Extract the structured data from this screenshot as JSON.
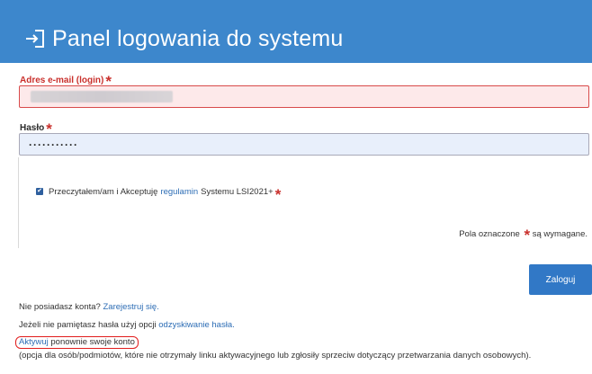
{
  "header": {
    "title": "Panel logowania do systemu",
    "icon": "login-icon",
    "background_color": "#3d87cc"
  },
  "form": {
    "email": {
      "label": "Adres e-mail (login)",
      "required_mark": "*",
      "value": "",
      "state": "error"
    },
    "password": {
      "label": "Hasło",
      "required_mark": "*",
      "value": "···········"
    },
    "terms": {
      "checked": true,
      "text_before": "Przeczytałem/am i Akceptuję",
      "link": "regulamin",
      "text_after": "Systemu LSI2021+",
      "required_mark": "*"
    },
    "required_note_before": "Pola oznaczone",
    "required_note_mark": "*",
    "required_note_after": "są wymagane.",
    "submit_label": "Zaloguj"
  },
  "footer": {
    "no_account_text": "Nie posiadasz konta?",
    "register_link": "Zarejestruj się.",
    "forgot_text": "Jeżeli nie pamiętasz hasła użyj opcji",
    "recover_link": "odzyskiwanie hasła.",
    "activate_link": "Aktywuj",
    "activate_text": "ponownie swoje konto",
    "activate_note": "(opcja dla osób/podmiotów, które nie otrzymały linku aktywacyjnego lub zgłosiły sprzeciw dotyczący przetwarzania danych osobowych)."
  },
  "colors": {
    "accent": "#3178c6",
    "error": "#c9302c",
    "link": "#2d6db5"
  }
}
